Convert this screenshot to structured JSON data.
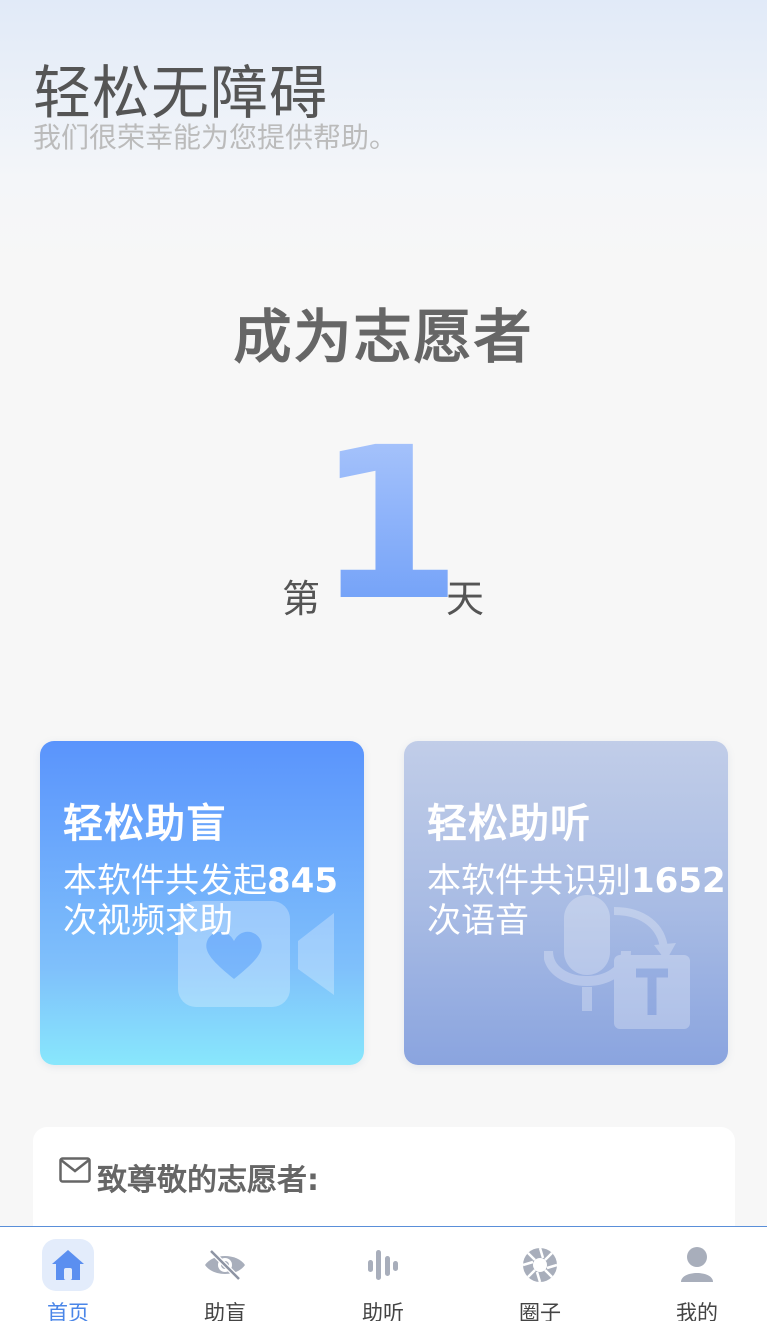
{
  "header": {
    "app_title": "轻松无障碍",
    "subtitle": "我们很荣幸能为您提供帮助。"
  },
  "headline": "成为志愿者",
  "day_counter": {
    "prefix": "第",
    "number": "1",
    "suffix": "天"
  },
  "cards": [
    {
      "title": "轻松助盲",
      "desc_prefix": "本软件共发起",
      "count": "845",
      "desc_suffix": "次视频求助",
      "icon": "video-call-icon"
    },
    {
      "title": "轻松助听",
      "desc_prefix": "本软件共识别",
      "count": "1652",
      "desc_suffix": "次语音",
      "icon": "voice-to-text-icon"
    }
  ],
  "letter": {
    "title": "致尊敬的志愿者:",
    "icon": "mail-icon"
  },
  "tabbar": {
    "tabs": [
      {
        "label": "首页",
        "icon": "home-icon",
        "active": true
      },
      {
        "label": "助盲",
        "icon": "eye-off-icon",
        "active": false
      },
      {
        "label": "助听",
        "icon": "audio-wave-icon",
        "active": false
      },
      {
        "label": "圈子",
        "icon": "aperture-icon",
        "active": false
      },
      {
        "label": "我的",
        "icon": "user-icon",
        "active": false
      }
    ]
  },
  "colors": {
    "accent": "#4a86e8",
    "card_blind_top": "#5a94fc",
    "card_blind_bottom": "#88e7fc",
    "card_hear_top": "#c1cde8",
    "card_hear_bottom": "#8aa4df"
  }
}
